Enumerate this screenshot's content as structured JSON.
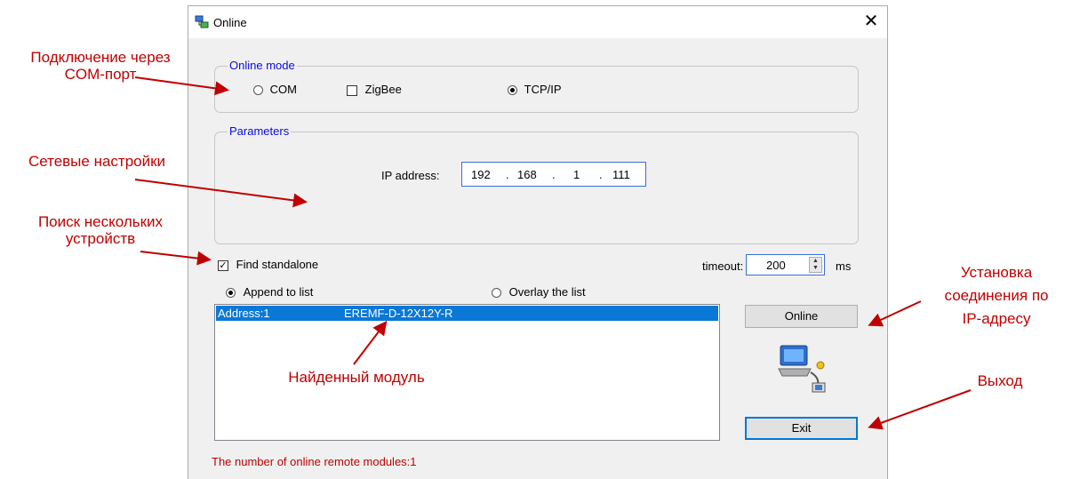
{
  "annotations": {
    "com_port": "Подключение через\nCOM-порт",
    "network": "Сетевые настройки",
    "multi_search": "Поиск нескольких\nустройств",
    "online_ip": "Установка\nсоединения по\nIP-адресу",
    "found_module": "Найденный модуль",
    "exit": "Выход"
  },
  "dialog": {
    "title": "Online",
    "close_glyph": "✕",
    "online_mode": {
      "legend": "Online mode",
      "com_label": "COM",
      "zigbee_label": "ZigBee",
      "tcpip_label": "TCP/IP",
      "selected": "TCP/IP"
    },
    "parameters": {
      "legend": "Parameters",
      "ip_label": "IP address:",
      "ip": [
        "192",
        "168",
        "1",
        "111"
      ],
      "dot": "."
    },
    "find_standalone": {
      "label": "Find standalone",
      "checked": true
    },
    "timeout": {
      "label": "timeout:",
      "value": "200",
      "unit": "ms"
    },
    "append_to_list": "Append to list",
    "overlay_list": "Overlay the list",
    "list": [
      {
        "address": "Address:1",
        "module": "EREMF-D-12X12Y-R"
      }
    ],
    "online_button": "Online",
    "exit_button": "Exit",
    "status": "The number of online remote modules:1"
  },
  "colors": {
    "annotation": "#c00000",
    "legend": "#0b0bdc",
    "selection": "#0a78d7"
  }
}
